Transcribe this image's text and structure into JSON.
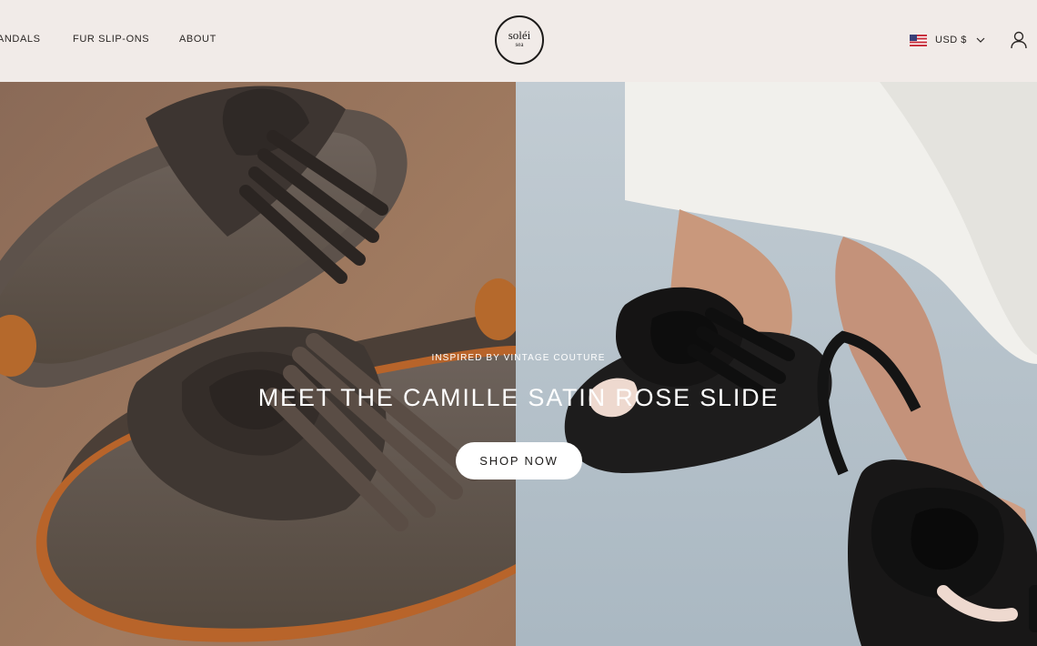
{
  "nav": {
    "items": [
      {
        "label": "SANDALS"
      },
      {
        "label": "FUR SLIP-ONS"
      },
      {
        "label": "ABOUT"
      }
    ]
  },
  "logo": {
    "line1": "soléi",
    "line2": "sea"
  },
  "currency": {
    "label": "USD $",
    "flag_icon": "us-flag-icon"
  },
  "account": {
    "icon": "user-icon"
  },
  "hero": {
    "eyebrow": "INSPIRED BY VINTAGE COUTURE",
    "headline": "MEET THE CAMILLE SATIN ROSE SLIDE",
    "cta_label": "SHOP NOW"
  },
  "colors": {
    "header_bg": "#f1ebe8",
    "left_bg": "#98755f",
    "right_bg": "#b7c3cc",
    "text_dark": "#2a2624"
  }
}
